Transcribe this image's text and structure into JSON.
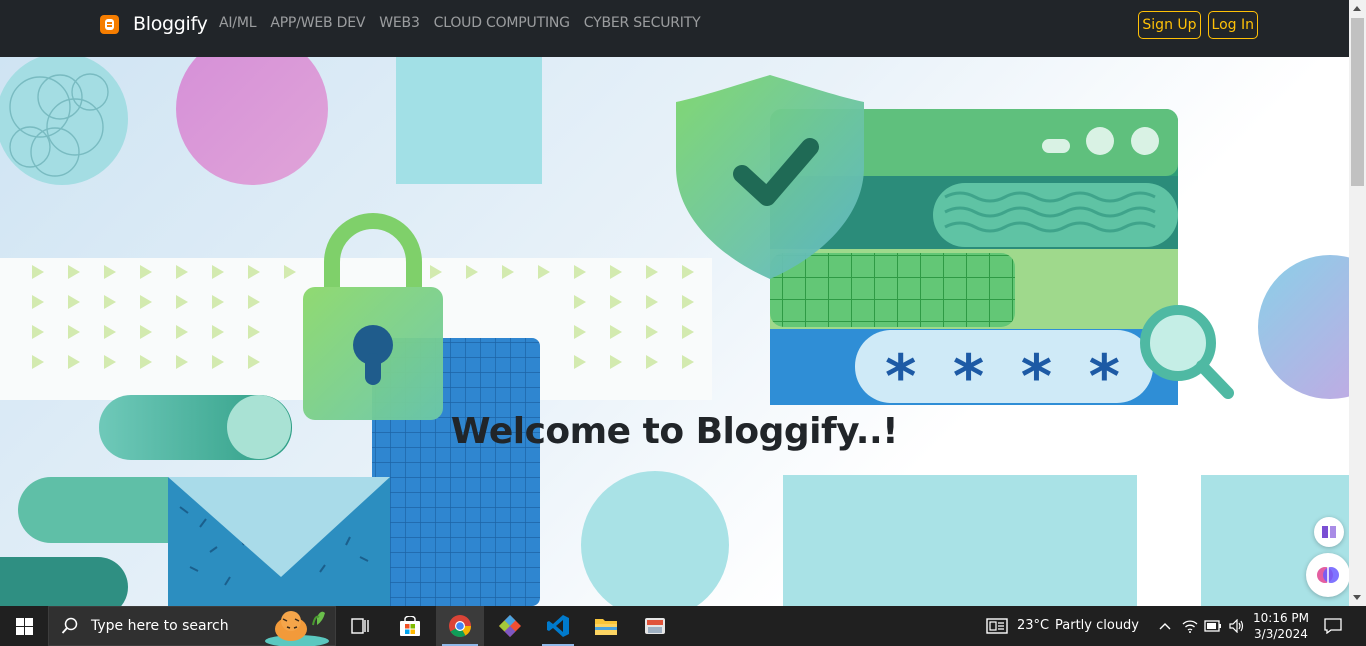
{
  "navbar": {
    "brand": "Bloggify",
    "links": [
      "AI/ML",
      "APP/WEB DEV",
      "WEB3",
      "CLOUD COMPUTING",
      "CYBER SECURITY"
    ],
    "signup_label": "Sign Up",
    "login_label": "Log In"
  },
  "hero": {
    "heading": "Welcome to Bloggify..!",
    "password_mask": "****"
  },
  "taskbar": {
    "search_placeholder": "Type here to search",
    "weather_temp": "23°C",
    "weather_desc": "Partly cloudy",
    "time": "10:16 PM",
    "date": "3/3/2024",
    "pinned": [
      "task-view-icon",
      "microsoft-store-icon",
      "chrome-icon",
      "git-icon",
      "vscode-icon",
      "file-explorer-icon",
      "app-icon"
    ]
  },
  "colors": {
    "navbar_bg": "#212529",
    "accent_warning": "#ffc107",
    "brand_logo": "#f57d00",
    "taskbar_bg": "#202020"
  }
}
